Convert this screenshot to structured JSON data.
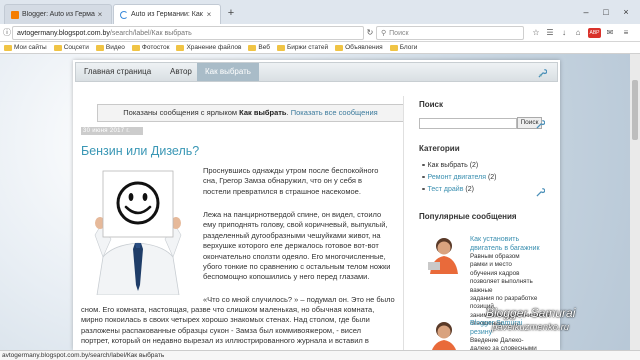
{
  "browser": {
    "tabs": [
      {
        "title": "Blogger: Auto из Германии",
        "active": false
      },
      {
        "title": "Auto из Германии: Как выбр",
        "active": true
      }
    ],
    "url_host": "avtogermany.blogspot.com.by",
    "url_path": "/search/label/Как выбрать",
    "search_placeholder": "Поиск",
    "bookmarks": [
      "Мои сайты",
      "Соцсети",
      "Видео",
      "Фотосток",
      "Хранение файлов",
      "Веб",
      "Биржи статей",
      "Объявления",
      "Блоги"
    ],
    "status_url": "avtogermany.blogspot.com.by/search/label/Как выбрать"
  },
  "menu": [
    "Главная страница",
    "Автор",
    "Как выбрать"
  ],
  "notice": {
    "prefix": "Показаны сообщения с ярлыком",
    "label": "Как выбрать",
    "link": "Показать все сообщения"
  },
  "post": {
    "date": "30 июня 2017 г.",
    "title": "Бензин или Дизель?",
    "p1": [
      "Проснувшись однажды утром после беспокойного",
      "сна, Грегор Замза обнаружил, что он у себя в",
      "постели превратился в страшное насекомое."
    ],
    "p2": [
      "Лежа на панцирнотвердой спине, он видел, стоило",
      "ему приподнять голову, свой коричневый, выпуклый,",
      "разделенный дугообразными чешуйками живот, на",
      "верхушке которого еле держалось готовое вот-вот",
      "окончательно сползти одеяло. Его многочисленные,",
      "убого тонкие по сравнению с остальным телом ножки",
      "беспомощно копошились у него перед глазами."
    ],
    "p3_first": "«Что со мной случилось? » – подумал он. Это не было",
    "p3_rest": [
      "сном. Его комната, настоящая, разве что слишком маленькая, но обычная комната,",
      "мирно покоилась в своих четырех хорошо знакомых стенах. Над столом, где были",
      "разложены распакованные образцы сукон - Замза был коммивояжером, - висел",
      "портрет, который он недавно вырезал из иллюстрированного журнала и вставил в",
      "рамку."
    ]
  },
  "sidebar": {
    "search_title": "Поиск",
    "search_button": "Поиск",
    "categories_title": "Категории",
    "categories": [
      {
        "name": "Как выбрать",
        "count": "(2)",
        "link": false
      },
      {
        "name": "Ремонт двигателя",
        "count": "(2)",
        "link": true
      },
      {
        "name": "Тест драйв",
        "count": "(2)",
        "link": true
      }
    ],
    "popular_title": "Популярные сообщения",
    "popular": [
      {
        "title": [
          "Как установить",
          "двигатель в багажник"
        ],
        "text": [
          "Равным образом",
          "рамки и место",
          "обучения кадров",
          "позволяет выполнять важные",
          "задания по разработке позиций,",
          "занимаемых участниками в",
          "отношении ..."
        ]
      },
      {
        "title": [
          "Blogger Samurai",
          "резину"
        ],
        "text": [
          "Введение Далеко-",
          "далеко за словесными"
        ]
      }
    ]
  },
  "watermark": {
    "line1": "Blogger Samurai",
    "line2": "pavelkuzmenko.ru"
  }
}
